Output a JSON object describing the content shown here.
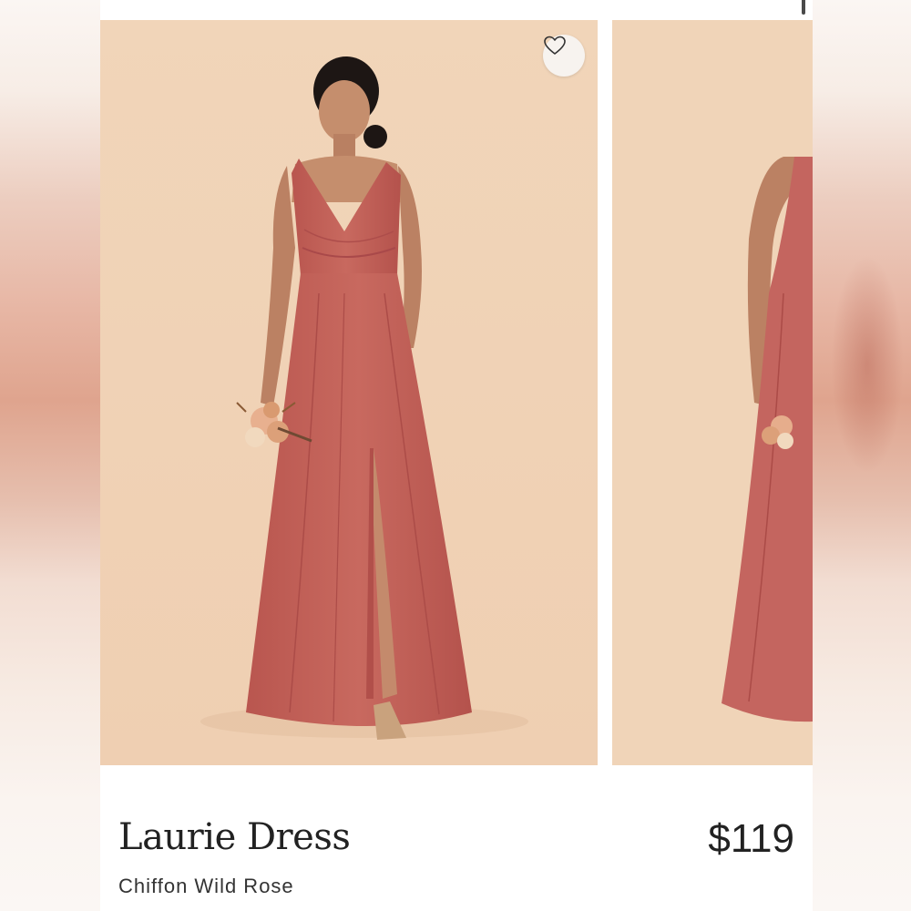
{
  "product": {
    "name": "Laurie Dress",
    "variant": "Chiffon Wild Rose",
    "price": "$119"
  },
  "icons": {
    "favorite": "heart-outline-icon"
  },
  "colors": {
    "backdrop": "#f0d4b8",
    "dress": "#c4655f",
    "text": "#222222"
  }
}
